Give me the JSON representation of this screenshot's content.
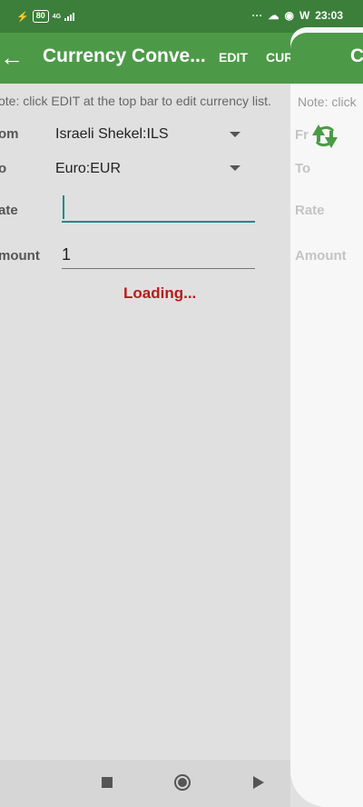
{
  "status_bar": {
    "battery": "80",
    "network": "4G",
    "dots": "···",
    "time": "23:03"
  },
  "toolbar": {
    "back_icon": "arrow-left-icon",
    "title": "Currency Conve...",
    "edit_label": "EDIT",
    "currency_label": "CURRENCY"
  },
  "note": "ote: click EDIT at the top bar to edit currency list.",
  "form": {
    "from_label": "om",
    "from_value": "Israeli Shekel:ILS",
    "to_label": "o",
    "to_value": "Euro:EUR",
    "rate_label": "ate",
    "rate_value": "",
    "amount_label": "mount",
    "amount_value": "1",
    "loading_text": "Loading..."
  },
  "overlay_card": {
    "title": "C",
    "note": "Note: click",
    "from_label": "Fr",
    "to_label": "To",
    "rate_label": "Rate",
    "amount_label": "Amount",
    "swap_icon": "swap-arrows-icon"
  },
  "nav": {
    "recents": "square-icon",
    "home": "circle-icon",
    "back": "triangle-icon"
  },
  "colors": {
    "status_bar": "#3b7f3b",
    "toolbar": "#4c9a47",
    "accent": "#178a84",
    "loading": "#b71b1b"
  }
}
